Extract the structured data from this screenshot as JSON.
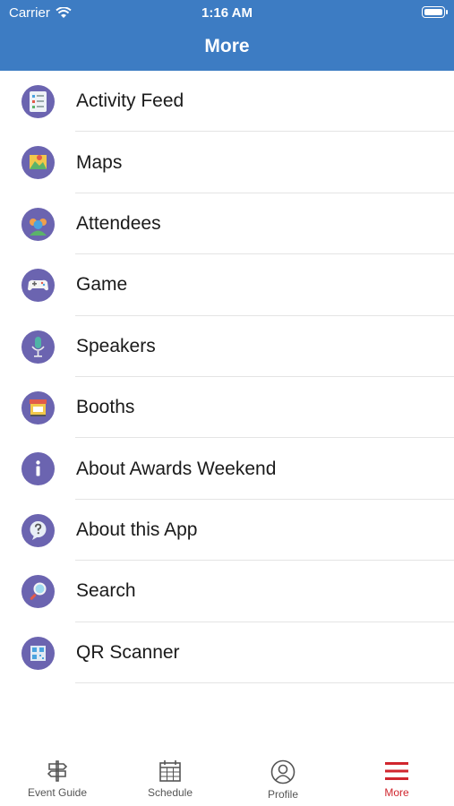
{
  "status": {
    "carrier": "Carrier",
    "time": "1:16 AM"
  },
  "header": {
    "title": "More"
  },
  "menu": [
    {
      "label": "Activity Feed",
      "icon": "activity-feed-icon"
    },
    {
      "label": "Maps",
      "icon": "map-icon"
    },
    {
      "label": "Attendees",
      "icon": "attendees-icon"
    },
    {
      "label": "Game",
      "icon": "gamepad-icon"
    },
    {
      "label": "Speakers",
      "icon": "microphone-icon"
    },
    {
      "label": "Booths",
      "icon": "booth-icon"
    },
    {
      "label": "About Awards Weekend",
      "icon": "info-icon"
    },
    {
      "label": "About this App",
      "icon": "help-bubble-icon"
    },
    {
      "label": "Search",
      "icon": "search-icon"
    },
    {
      "label": "QR Scanner",
      "icon": "qr-code-icon"
    }
  ],
  "tabs": [
    {
      "label": "Event Guide",
      "icon": "signpost-icon"
    },
    {
      "label": "Schedule",
      "icon": "calendar-icon"
    },
    {
      "label": "Profile",
      "icon": "profile-icon"
    },
    {
      "label": "More",
      "icon": "menu-icon",
      "active": true
    }
  ],
  "colors": {
    "header": "#3d7cc3",
    "icon_bg": "#6b64b0",
    "active_tab": "#d0262e"
  }
}
